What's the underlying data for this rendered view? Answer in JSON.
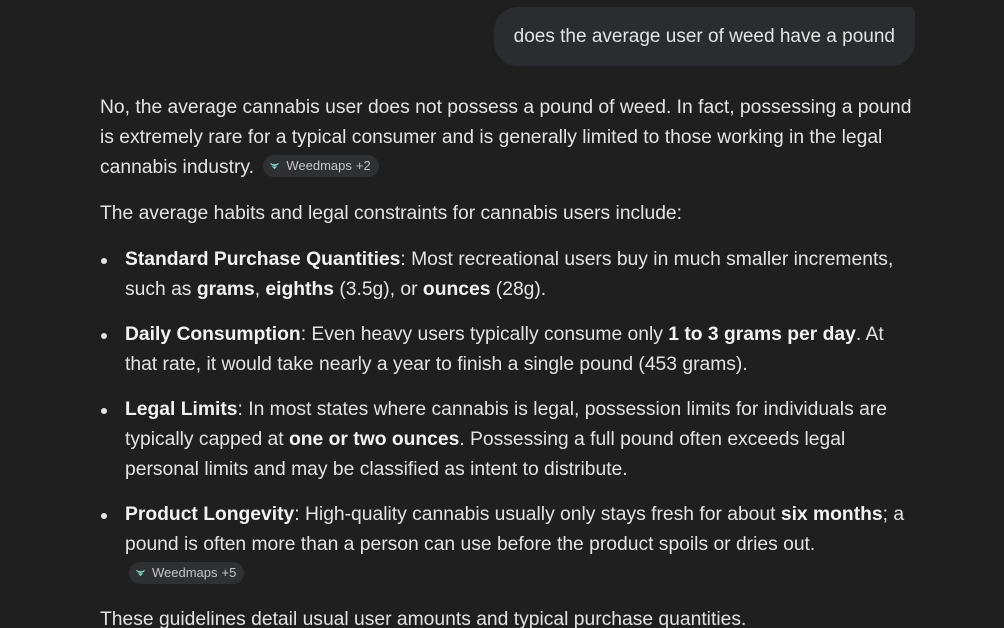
{
  "user_message": "does the average user of weed have a pound",
  "response": {
    "intro": "No, the average cannabis user does not possess a pound of weed. In fact, possessing a pound is extremely rare for a typical consumer and is generally limited to those working in the legal cannabis industry.",
    "intro_citation": {
      "source": "Weedmaps",
      "extra": "+2",
      "icon": "weedmaps-favicon"
    },
    "lead": "The average habits and legal constraints for cannabis users include:",
    "items": [
      {
        "title": "Standard Purchase Quantities",
        "t1": ": Most recreational users buy in much smaller increments, such as ",
        "b1": "grams",
        "t2": ", ",
        "b2": "eighths",
        "t3": " (3.5g), or ",
        "b3": "ounces",
        "t4": " (28g)."
      },
      {
        "title": "Daily Consumption",
        "t1": ": Even heavy users typically consume only ",
        "b1": "1 to 3 grams per day",
        "t2": ". At that rate, it would take nearly a year to finish a single pound (453 grams)."
      },
      {
        "title": "Legal Limits",
        "t1": ": In most states where cannabis is legal, possession limits for individuals are typically capped at ",
        "b1": "one or two ounces",
        "t2": ". Possessing a full pound often exceeds legal personal limits and may be classified as intent to distribute."
      },
      {
        "title": "Product Longevity",
        "t1": ": High-quality cannabis usually only stays fresh for about ",
        "b1": "six months",
        "t2": "; a pound is often more than a person can use before the product spoils or dries out.",
        "citation": {
          "source": "Weedmaps",
          "extra": "+5",
          "icon": "weedmaps-favicon"
        }
      }
    ],
    "outro": "These guidelines detail usual user amounts and typical purchase quantities."
  },
  "colors": {
    "background": "#1f1f1f",
    "bubble": "#2b2c2f",
    "text": "#e3e3e3",
    "chip": "#2f3032",
    "favicon": "#7fd1c6"
  }
}
